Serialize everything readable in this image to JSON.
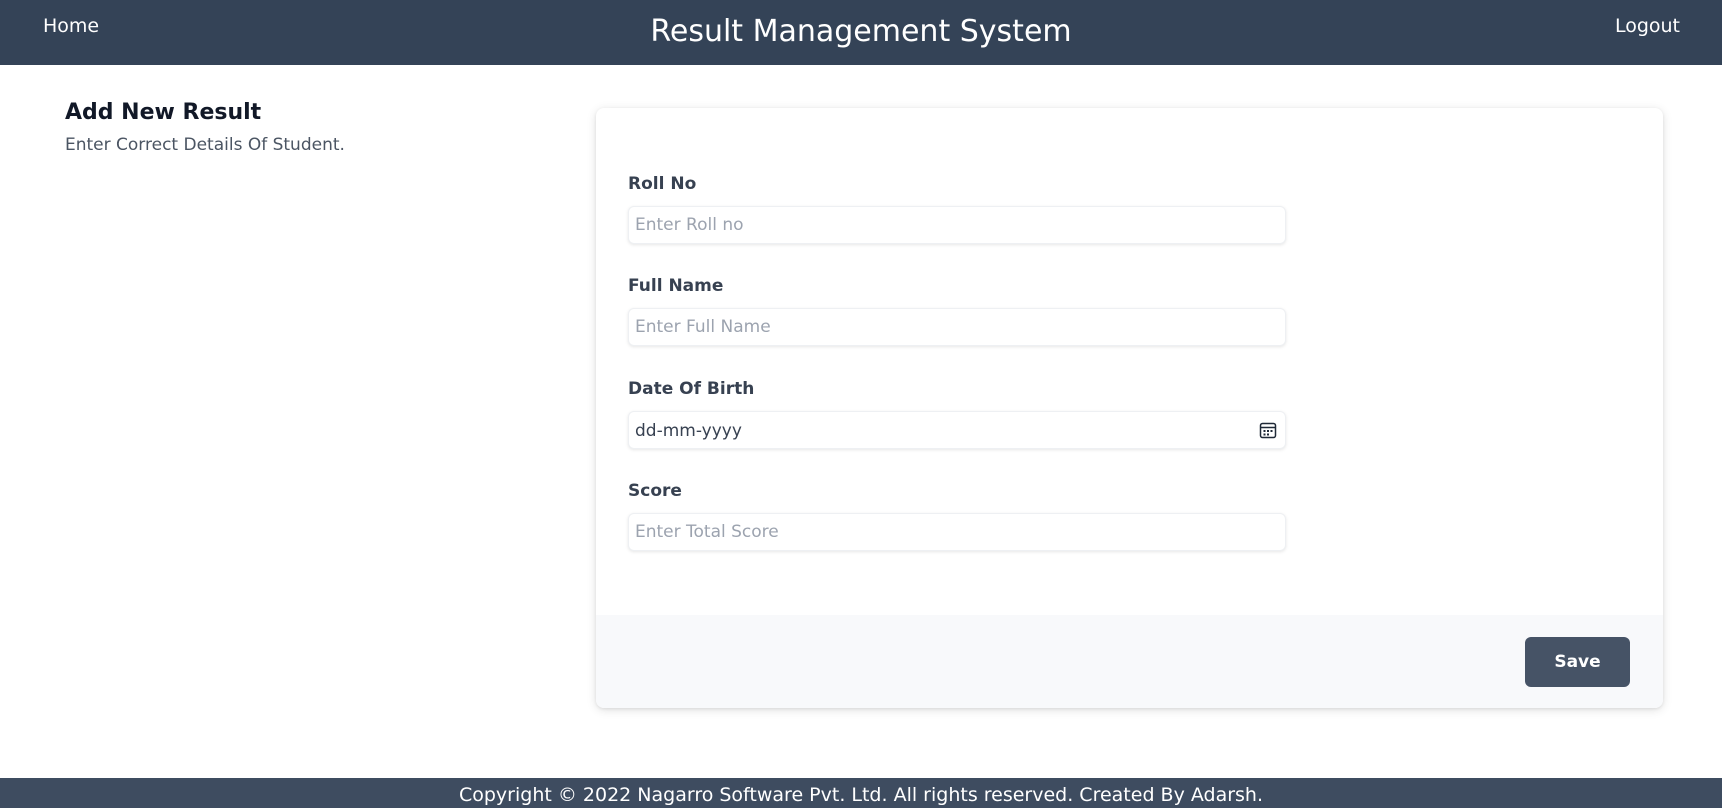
{
  "header": {
    "home_label": "Home",
    "title": "Result Management System",
    "logout_label": "Logout"
  },
  "intro": {
    "title": "Add New Result",
    "subtitle": "Enter Correct Details Of Student."
  },
  "form": {
    "roll_no": {
      "label": "Roll No",
      "placeholder": "Enter Roll no",
      "value": ""
    },
    "full_name": {
      "label": "Full Name",
      "placeholder": "Enter Full Name",
      "value": ""
    },
    "dob": {
      "label": "Date Of Birth",
      "value": "dd-mm-yyyy",
      "icon": "calendar-icon"
    },
    "score": {
      "label": "Score",
      "placeholder": "Enter Total Score",
      "value": ""
    },
    "save_label": "Save"
  },
  "footer": {
    "text": "Copyright © 2022 Nagarro Software Pvt. Ltd. All rights reserved. Created By Adarsh."
  },
  "colors": {
    "header_bg": "#344357",
    "footer_bg": "#3e4c60",
    "button_bg": "#465366",
    "card_footer_bg": "#f8f9fb"
  }
}
